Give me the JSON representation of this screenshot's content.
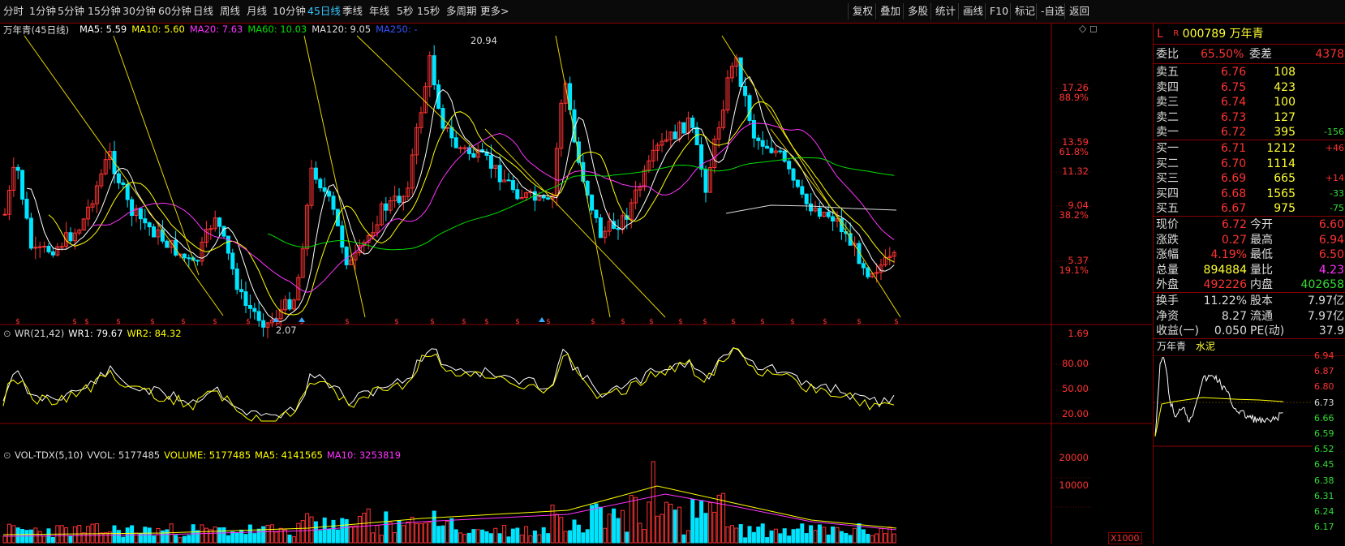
{
  "toolbar": {
    "periods": [
      "分时",
      "1分钟",
      "5分钟",
      "15分钟",
      "30分钟",
      "60分钟",
      "日线",
      "周线",
      "月线",
      "10分钟",
      "45日线",
      "季线",
      "年线",
      "5秒",
      "15秒",
      "多周期",
      "更多>"
    ],
    "active_period": "45日线",
    "right_buttons": [
      "复权",
      "叠加",
      "多股",
      "统计",
      "画线",
      "F10",
      "标记",
      "-自选",
      "返回"
    ]
  },
  "main": {
    "title": "万年青(45日线)",
    "ma_legend": [
      {
        "label": "MA5: 5.59",
        "color": "#ffffff"
      },
      {
        "label": "MA10: 5.60",
        "color": "#ffff00"
      },
      {
        "label": "MA20: 7.63",
        "color": "#ff33ff"
      },
      {
        "label": "MA60: 10.03",
        "color": "#00e000"
      },
      {
        "label": "MA120: 9.05",
        "color": "#dcdcdc"
      },
      {
        "label": "MA250: -",
        "color": "#3355ff"
      }
    ],
    "price_axis": [
      {
        "v": "17.26",
        "sub": "88.9%"
      },
      {
        "v": "13.59",
        "sub": "61.8%"
      },
      {
        "v": "11.32",
        "sub": ""
      },
      {
        "v": "9.04",
        "sub": "38.2%"
      },
      {
        "v": "5.37",
        "sub": "19.1%"
      },
      {
        "v": "1.69",
        "sub": ""
      }
    ],
    "high_marker": "20.94",
    "low_marker": "2.07"
  },
  "wr": {
    "legend": [
      {
        "label": "WR(21,42)",
        "color": "#dcdcdc"
      },
      {
        "label": "WR1: 79.67",
        "color": "#ffffff"
      },
      {
        "label": "WR2: 84.32",
        "color": "#ffff00"
      }
    ],
    "axis": [
      "80.00",
      "50.00",
      "20.00"
    ]
  },
  "vol": {
    "legend": [
      {
        "label": "VOL-TDX(5,10)",
        "color": "#dcdcdc"
      },
      {
        "label": "VVOL: 5177485",
        "color": "#dcdcdc"
      },
      {
        "label": "VOLUME: 5177485",
        "color": "#ffff00"
      },
      {
        "label": "MA5: 4141565",
        "color": "#ffff00"
      },
      {
        "label": "MA10: 3253819",
        "color": "#ff33ff"
      }
    ],
    "axis": [
      "20000",
      "10000"
    ],
    "unit": "X1000"
  },
  "panel": {
    "L": "L",
    "R": "R",
    "code": "000789",
    "name": "万年青",
    "weibi": {
      "label": "委比",
      "value": "65.50%",
      "label2": "委差",
      "value2": "4378"
    },
    "sells": [
      {
        "label": "卖五",
        "price": "6.76",
        "vol": "108",
        "chg": ""
      },
      {
        "label": "卖四",
        "price": "6.75",
        "vol": "423",
        "chg": ""
      },
      {
        "label": "卖三",
        "price": "6.74",
        "vol": "100",
        "chg": ""
      },
      {
        "label": "卖二",
        "price": "6.73",
        "vol": "127",
        "chg": ""
      },
      {
        "label": "卖一",
        "price": "6.72",
        "vol": "395",
        "chg": "-156"
      }
    ],
    "buys": [
      {
        "label": "买一",
        "price": "6.71",
        "vol": "1212",
        "chg": "+46"
      },
      {
        "label": "买二",
        "price": "6.70",
        "vol": "1114",
        "chg": ""
      },
      {
        "label": "买三",
        "price": "6.69",
        "vol": "665",
        "chg": "+14"
      },
      {
        "label": "买四",
        "price": "6.68",
        "vol": "1565",
        "chg": "-33"
      },
      {
        "label": "买五",
        "price": "6.67",
        "vol": "975",
        "chg": "-75"
      }
    ],
    "stats": [
      {
        "l1": "现价",
        "v1": "6.72",
        "c1": "#ff3333",
        "l2": "今开",
        "v2": "6.60",
        "c2": "#ff3333"
      },
      {
        "l1": "涨跌",
        "v1": "0.27",
        "c1": "#ff3333",
        "l2": "最高",
        "v2": "6.94",
        "c2": "#ff3333"
      },
      {
        "l1": "涨幅",
        "v1": "4.19%",
        "c1": "#ff3333",
        "l2": "最低",
        "v2": "6.50",
        "c2": "#ff3333"
      },
      {
        "l1": "总量",
        "v1": "894884",
        "c1": "#ffff33",
        "l2": "量比",
        "v2": "4.23",
        "c2": "#ff33ff"
      },
      {
        "l1": "外盘",
        "v1": "492226",
        "c1": "#ff3333",
        "l2": "内盘",
        "v2": "402658",
        "c2": "#33dd33"
      }
    ],
    "stats2": [
      {
        "l1": "换手",
        "v1": "11.22%",
        "l2": "股本",
        "v2": "7.97亿"
      },
      {
        "l1": "净资",
        "v1": "8.27",
        "l2": "流通",
        "v2": "7.97亿"
      },
      {
        "l1": "收益(一)",
        "v1": "0.050",
        "l2": "PE(动)",
        "v2": "37.9"
      }
    ],
    "mini_tabs": [
      "万年青",
      "水泥"
    ],
    "mini_axis": [
      "6.94",
      "6.87",
      "6.80",
      "6.73",
      "6.66",
      "6.59",
      "6.52",
      "6.45",
      "6.38",
      "6.31",
      "6.24",
      "6.17"
    ]
  },
  "colors": {
    "up": "#ff3333",
    "down": "#00e5ff",
    "frame": "#8b0000"
  }
}
